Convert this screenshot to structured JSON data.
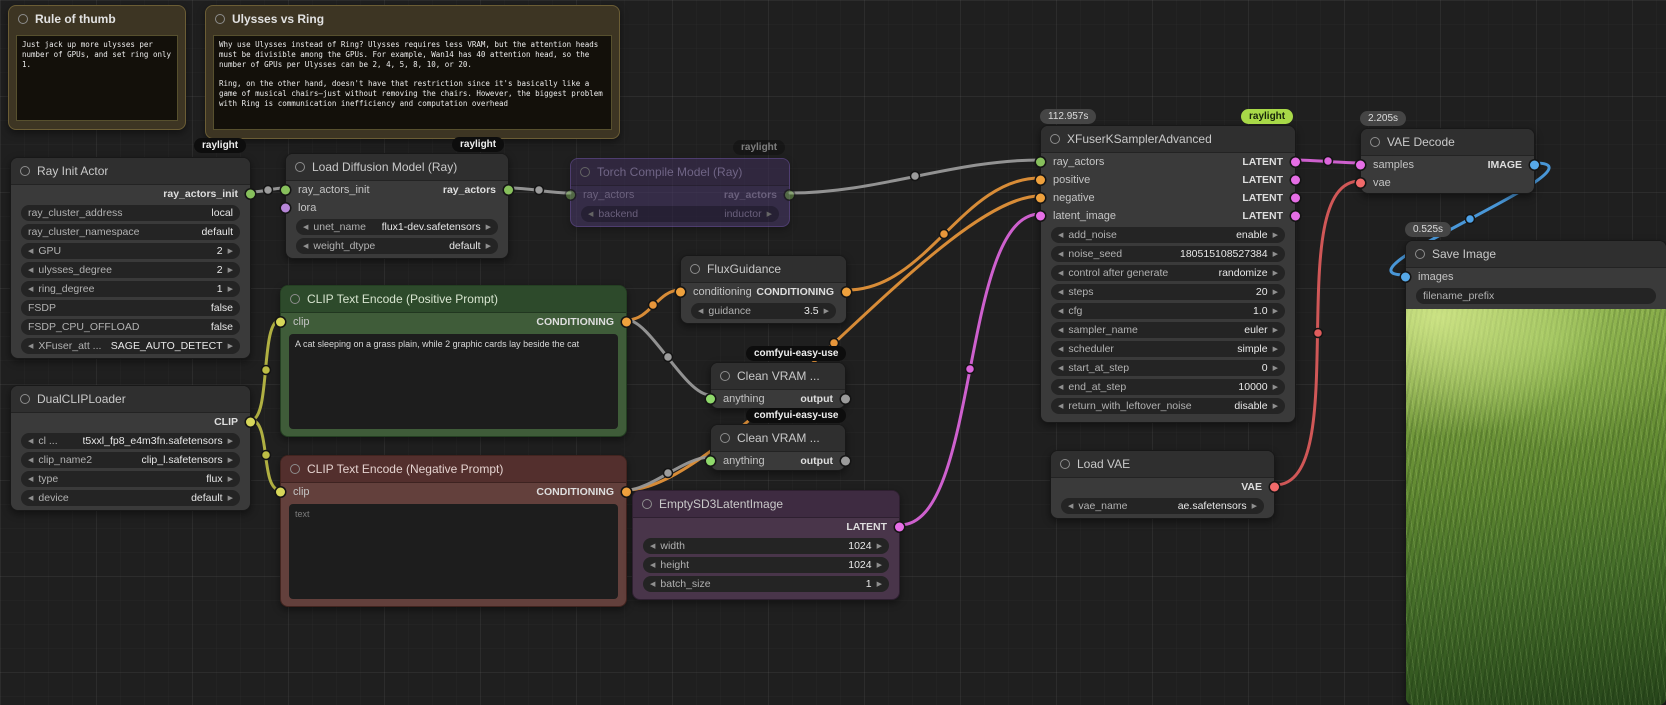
{
  "icons": {
    "left_arrow": "◀",
    "right_arrow": "▶"
  },
  "colors": {
    "background": "#1f1f1f",
    "link_ray": "#9c9c9c",
    "link_clip": "#bdbd45",
    "link_conditioning": "#e8963a",
    "link_latent": "#dd66dd",
    "link_vae": "#e05c5c",
    "link_image": "#4da2e8",
    "port_clip": "#d7d75a",
    "port_conditioning": "#efa13d",
    "port_latent": "#e66ee6",
    "port_vae": "#f16a6a",
    "port_image": "#56a8e8",
    "port_ray": "#87c05c",
    "badge_raylight_green": "#a8d948"
  },
  "notes": {
    "rule_of_thumb": {
      "title": "Rule of thumb",
      "body": "Just jack up more ulysses per number of GPUs, and set ring only 1."
    },
    "ulysses_vs_ring": {
      "title": "Ulysses vs Ring",
      "body": "Why use Ulysses instead of Ring? Ulysses requires less VRAM, but the attention heads must be divisible among the GPUs. For example, Wan14 has 40 attention head, so the number of GPUs per Ulysses can be 2, 4, 5, 8, 10, or 20.\n\nRing, on the other hand, doesn't have that restriction since it's basically like a game of musical chairs—just without removing the chairs. However, the biggest problem with Ring is communication inefficiency and computation overhead"
    }
  },
  "badges": {
    "raylight": "raylight",
    "comfyui_easy_use": "comfyui-easy-use",
    "xfuser_time": "112.957s",
    "vae_decode_time": "2.205s",
    "save_image_time": "0.525s"
  },
  "nodes": {
    "ray_init": {
      "title": "Ray Init Actor",
      "outputs": [
        "ray_actors_init"
      ],
      "widgets": [
        {
          "name": "ray_cluster_address",
          "value": "local"
        },
        {
          "name": "ray_cluster_namespace",
          "value": "default"
        },
        {
          "name": "GPU",
          "value": "2"
        },
        {
          "name": "ulysses_degree",
          "value": "2"
        },
        {
          "name": "ring_degree",
          "value": "1"
        },
        {
          "name": "FSDP",
          "value": "false"
        },
        {
          "name": "FSDP_CPU_OFFLOAD",
          "value": "false"
        },
        {
          "name": "XFuser_att ...",
          "value": "SAGE_AUTO_DETECT"
        }
      ]
    },
    "dual_clip_loader": {
      "title": "DualCLIPLoader",
      "outputs": [
        "CLIP"
      ],
      "widgets": [
        {
          "name": "cl ...",
          "value": "t5xxl_fp8_e4m3fn.safetensors"
        },
        {
          "name": "clip_name2",
          "value": "clip_l.safetensors"
        },
        {
          "name": "type",
          "value": "flux"
        },
        {
          "name": "device",
          "value": "default"
        }
      ]
    },
    "load_diffusion": {
      "title": "Load Diffusion Model (Ray)",
      "inputs": [
        "ray_actors_init",
        "lora"
      ],
      "outputs": [
        "ray_actors"
      ],
      "widgets": [
        {
          "name": "unet_name",
          "value": "flux1-dev.safetensors"
        },
        {
          "name": "weight_dtype",
          "value": "default"
        }
      ]
    },
    "torch_compile": {
      "title": "Torch Compile Model (Ray)",
      "inputs": [
        "ray_actors"
      ],
      "outputs": [
        "ray_actors"
      ],
      "widgets": [
        {
          "name": "backend",
          "value": "inductor"
        }
      ]
    },
    "flux_guidance": {
      "title": "FluxGuidance",
      "inputs": [
        "conditioning"
      ],
      "outputs": [
        "CONDITIONING"
      ],
      "widgets": [
        {
          "name": "guidance",
          "value": "3.5"
        }
      ]
    },
    "clip_positive": {
      "title": "CLIP Text Encode (Positive Prompt)",
      "inputs": [
        "clip"
      ],
      "outputs": [
        "CONDITIONING"
      ],
      "text": "A cat sleeping on a grass plain, while 2 graphic cards lay beside the cat"
    },
    "clip_negative": {
      "title": "CLIP Text Encode (Negative Prompt)",
      "inputs": [
        "clip"
      ],
      "outputs": [
        "CONDITIONING"
      ],
      "text": "text"
    },
    "clean_vram_1": {
      "title": "Clean VRAM ...",
      "inputs": [
        "anything"
      ],
      "outputs": [
        "output"
      ]
    },
    "clean_vram_2": {
      "title": "Clean VRAM ...",
      "inputs": [
        "anything"
      ],
      "outputs": [
        "output"
      ]
    },
    "empty_latent": {
      "title": "EmptySD3LatentImage",
      "outputs": [
        "LATENT"
      ],
      "widgets": [
        {
          "name": "width",
          "value": "1024"
        },
        {
          "name": "height",
          "value": "1024"
        },
        {
          "name": "batch_size",
          "value": "1"
        }
      ]
    },
    "xfuser_ksampler": {
      "title": "XFuserKSamplerAdvanced",
      "inputs": [
        "ray_actors",
        "positive",
        "negative",
        "latent_image"
      ],
      "outputs": [
        "LATENT",
        "LATENT",
        "LATENT",
        "LATENT"
      ],
      "widgets": [
        {
          "name": "add_noise",
          "value": "enable"
        },
        {
          "name": "noise_seed",
          "value": "180515108527384"
        },
        {
          "name": "control after generate",
          "value": "randomize"
        },
        {
          "name": "steps",
          "value": "20"
        },
        {
          "name": "cfg",
          "value": "1.0"
        },
        {
          "name": "sampler_name",
          "value": "euler"
        },
        {
          "name": "scheduler",
          "value": "simple"
        },
        {
          "name": "start_at_step",
          "value": "0"
        },
        {
          "name": "end_at_step",
          "value": "10000"
        },
        {
          "name": "return_with_leftover_noise",
          "value": "disable"
        }
      ]
    },
    "load_vae": {
      "title": "Load VAE",
      "outputs": [
        "VAE"
      ],
      "widgets": [
        {
          "name": "vae_name",
          "value": "ae.safetensors"
        }
      ]
    },
    "vae_decode": {
      "title": "VAE Decode",
      "inputs": [
        "samples",
        "vae"
      ],
      "outputs": [
        "IMAGE"
      ]
    },
    "save_image": {
      "title": "Save Image",
      "inputs": [
        "images"
      ],
      "widgets": [
        {
          "name": "filename_prefix",
          "value": ""
        }
      ]
    }
  }
}
